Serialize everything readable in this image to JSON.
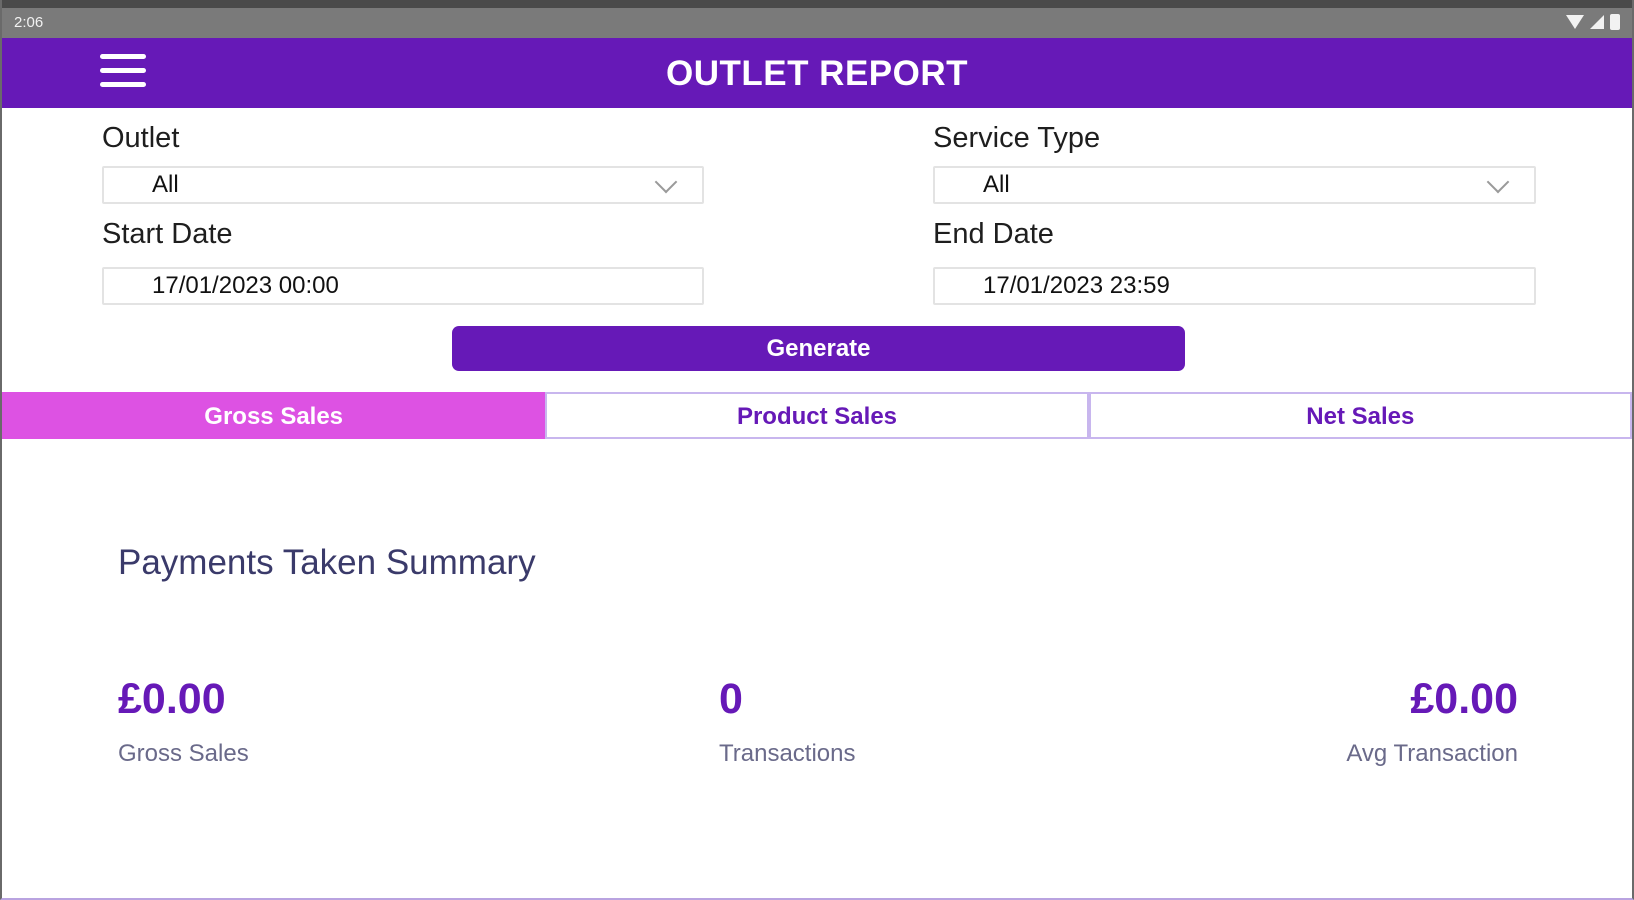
{
  "status_bar": {
    "time": "2:06"
  },
  "app_bar": {
    "title": "OUTLET REPORT",
    "menu_icon": "hamburger-menu-icon"
  },
  "filters": {
    "outlet": {
      "label": "Outlet",
      "value": "All"
    },
    "service_type": {
      "label": "Service Type",
      "value": "All"
    },
    "start_date": {
      "label": "Start Date",
      "value": "17/01/2023 00:00"
    },
    "end_date": {
      "label": "End Date",
      "value": "17/01/2023 23:59"
    }
  },
  "generate_label": "Generate",
  "tabs": [
    {
      "label": "Gross Sales",
      "active": true
    },
    {
      "label": "Product Sales",
      "active": false
    },
    {
      "label": "Net Sales",
      "active": false
    }
  ],
  "summary": {
    "title": "Payments Taken Summary",
    "metrics": [
      {
        "value": "£0.00",
        "label": "Gross Sales"
      },
      {
        "value": "0",
        "label": "Transactions"
      },
      {
        "value": "£0.00",
        "label": "Avg Transaction"
      }
    ]
  },
  "colors": {
    "primary": "#6619b7",
    "tab_active": "#dd52e3",
    "status_bar": "#7a7a7a"
  }
}
